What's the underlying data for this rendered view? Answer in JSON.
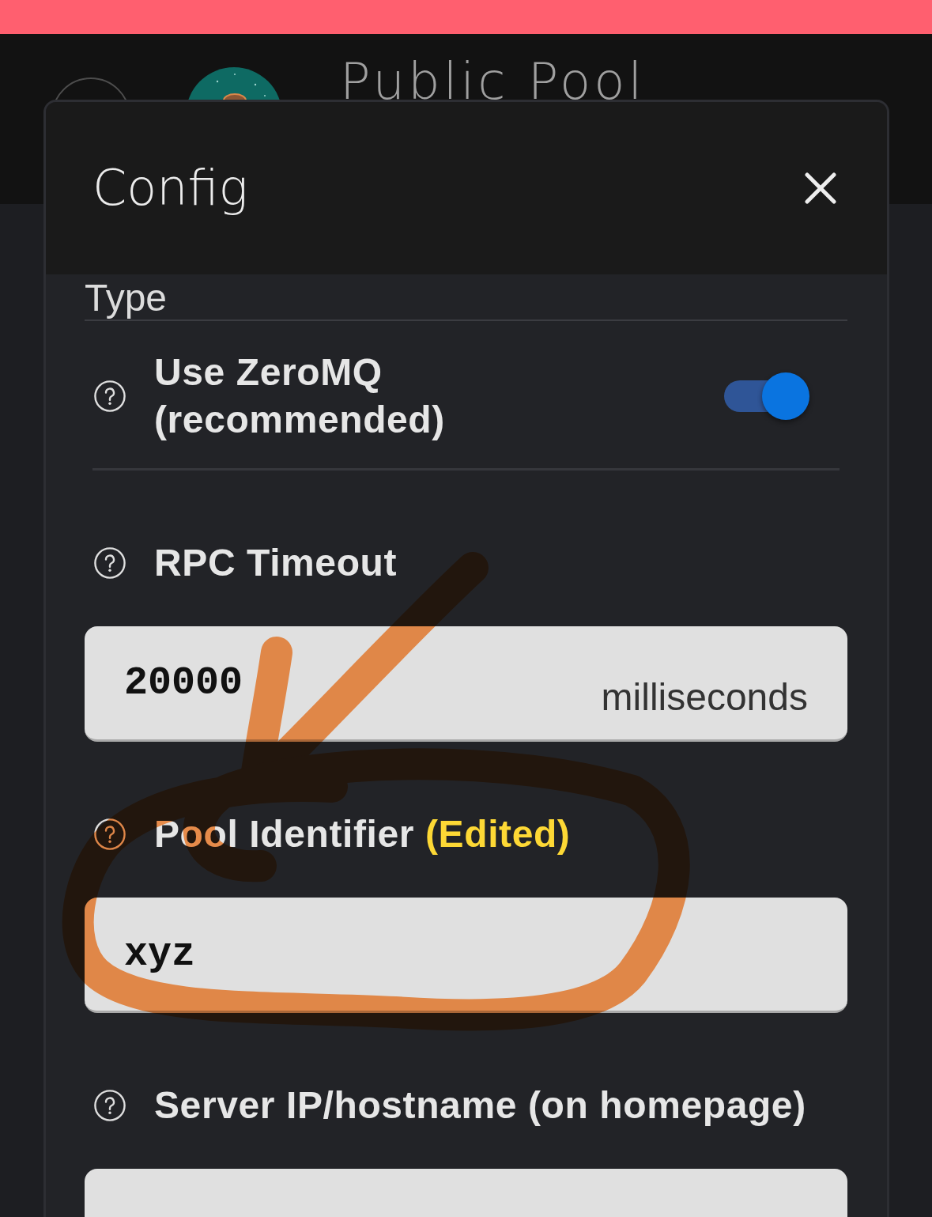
{
  "header": {
    "title": "Public Pool"
  },
  "dialog": {
    "title": "Config",
    "section": {
      "title": "Type"
    },
    "toggle": {
      "label": "Use ZeroMQ (recommended)",
      "on": true
    },
    "fields": [
      {
        "label": "RPC Timeout",
        "value": "20000",
        "unit": "milliseconds"
      },
      {
        "label": "Pool Identifier",
        "badge": "(Edited)",
        "value": "xyz"
      },
      {
        "label": "Server IP/hostname (on homepage)"
      }
    ]
  }
}
